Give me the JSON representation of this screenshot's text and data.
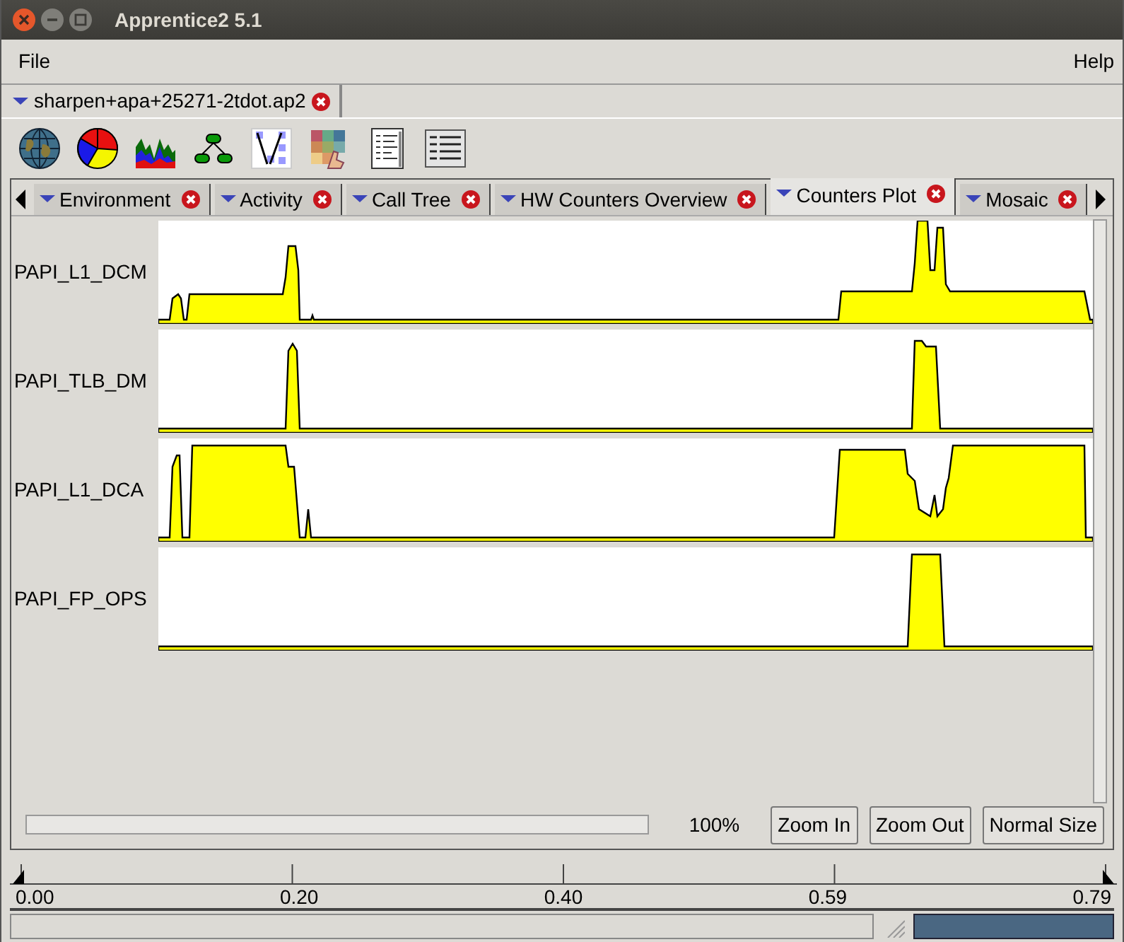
{
  "window": {
    "title": "Apprentice2 5.1"
  },
  "menu": [
    {
      "label": "File"
    },
    {
      "label": "Help"
    }
  ],
  "file_tabs": [
    {
      "label": "sharpen+apa+25271-2tdot.ap2",
      "selected": true
    }
  ],
  "tabs": [
    {
      "label": "Environment",
      "selected": false
    },
    {
      "label": "Activity",
      "selected": false
    },
    {
      "label": "Call Tree",
      "selected": false
    },
    {
      "label": "HW Counters Overview",
      "selected": false
    },
    {
      "label": "Counters Plot",
      "selected": true
    },
    {
      "label": "Mosaic",
      "selected": false
    }
  ],
  "plot": {
    "rows": [
      {
        "label": "PAPI_L1_DCM"
      },
      {
        "label": "PAPI_TLB_DM"
      },
      {
        "label": "PAPI_L1_DCA"
      },
      {
        "label": "PAPI_FP_OPS"
      }
    ]
  },
  "zoom": {
    "percent": "100%",
    "buttons": [
      "Zoom In",
      "Zoom Out",
      "Normal Size"
    ]
  },
  "ruler": {
    "ticks": [
      "0.00",
      "0.20",
      "0.40",
      "0.59",
      "0.79"
    ]
  }
}
